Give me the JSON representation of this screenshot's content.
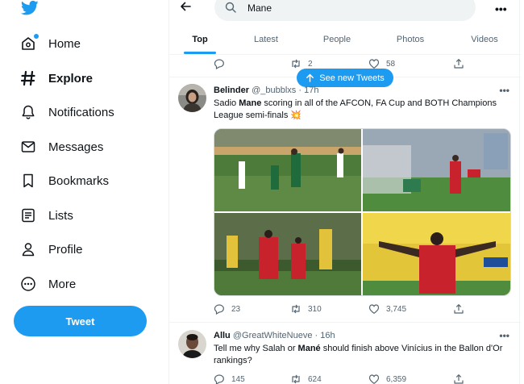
{
  "sidebar": {
    "items": [
      {
        "label": "Home",
        "icon": "home-icon"
      },
      {
        "label": "Explore",
        "icon": "hashtag-icon"
      },
      {
        "label": "Notifications",
        "icon": "bell-icon"
      },
      {
        "label": "Messages",
        "icon": "envelope-icon"
      },
      {
        "label": "Bookmarks",
        "icon": "bookmark-icon"
      },
      {
        "label": "Lists",
        "icon": "list-icon"
      },
      {
        "label": "Profile",
        "icon": "person-icon"
      },
      {
        "label": "More",
        "icon": "more-circle-icon"
      }
    ],
    "active": "Explore",
    "tweet_button": "Tweet"
  },
  "search": {
    "value": "Mane"
  },
  "tabs": [
    "Top",
    "Latest",
    "People",
    "Photos",
    "Videos"
  ],
  "active_tab": "Top",
  "prev_tweet": {
    "retweets": "2",
    "likes": "58"
  },
  "new_tweets_pill": "See new Tweets",
  "tweets": [
    {
      "name": "Belinder",
      "handle": "@_bubblxs",
      "sep": "·",
      "time": "17h",
      "text_pre": "Sadio ",
      "text_bold": "Mane",
      "text_line1_post": " scoring in all of the AFCON, FA Cup and BOTH Champions",
      "text_line2": "League semi-finals 💥",
      "replies": "23",
      "retweets": "310",
      "likes": "3,745"
    },
    {
      "name": "Allu",
      "handle": "@GreatWhiteNueve",
      "sep": "·",
      "time": "16h",
      "text_pre": "Tell me why Salah or ",
      "text_bold": "Mané",
      "text_line1_post": " should finish above Vinícius in the Ballon d'Or",
      "text_line2": "rankings?",
      "replies": "145",
      "retweets": "624",
      "likes": "6,359"
    }
  ],
  "colors": {
    "accent": "#1d9bf0",
    "text": "#0f1419",
    "muted": "#536471",
    "border": "#eff3f4"
  }
}
